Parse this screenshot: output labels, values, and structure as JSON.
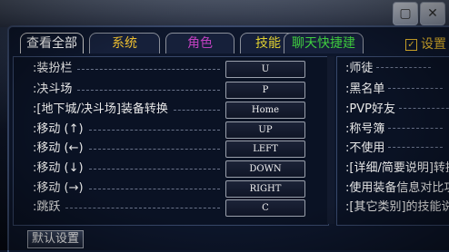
{
  "tabs": [
    {
      "label": "查看全部",
      "color": "#ffffff",
      "active": true
    },
    {
      "label": "系统",
      "color": "#f0c030"
    },
    {
      "label": "角色",
      "color": "#c040c0"
    },
    {
      "label": "技能",
      "color": "#e0d030"
    },
    {
      "label": "聊天快捷建",
      "color": "#40d040"
    }
  ],
  "settings_tab": {
    "label": "设置",
    "checked": "✓"
  },
  "window_buttons": [
    "✕",
    "▢"
  ],
  "left_rows": [
    {
      "label": ":装扮栏",
      "key": "U"
    },
    {
      "label": ":决斗场",
      "key": "P"
    },
    {
      "label": ":[地下城/决斗场]装备转换",
      "key": "Home"
    },
    {
      "label": ":移动 (↑)",
      "key": "UP"
    },
    {
      "label": ":移动 (←)",
      "key": "LEFT"
    },
    {
      "label": ":移动 (↓)",
      "key": "DOWN"
    },
    {
      "label": ":移动 (→)",
      "key": "RIGHT"
    },
    {
      "label": ":跳跃",
      "key": "C"
    }
  ],
  "right_rows": [
    ":师徒",
    ":黑名单",
    ":PVP好友",
    ":称号簿",
    ":不使用",
    ":[详细/简要说明]转换",
    ":使用装备信息对比功能",
    ":[其它类别]的技能说明"
  ],
  "default_button": "默认设置"
}
